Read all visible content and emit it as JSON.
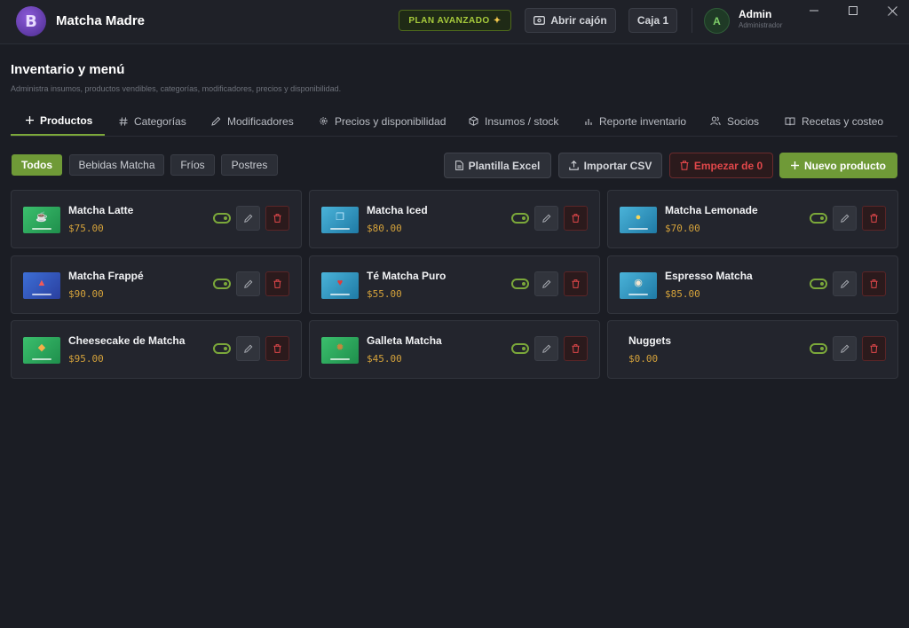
{
  "app": {
    "title": "Matcha Madre",
    "logo_letter": "B",
    "plan_badge": "PLAN AVANZADO",
    "open_drawer": "Abrir cajón",
    "register": "Caja 1",
    "user": {
      "initial": "A",
      "name": "Admin",
      "role": "Administrador"
    }
  },
  "page": {
    "title": "Inventario y menú",
    "subtitle": "Administra insumos, productos vendibles, categorías, modificadores, precios y disponibilidad."
  },
  "tabs": [
    {
      "label": "Productos",
      "icon": "plus-icon",
      "active": true
    },
    {
      "label": "Categorías",
      "icon": "hash-icon"
    },
    {
      "label": "Modificadores",
      "icon": "pencil-icon"
    },
    {
      "label": "Precios y disponibilidad",
      "icon": "gear-icon"
    },
    {
      "label": "Insumos / stock",
      "icon": "box-icon"
    },
    {
      "label": "Reporte inventario",
      "icon": "bar-chart-icon"
    },
    {
      "label": "Socios",
      "icon": "users-icon"
    },
    {
      "label": "Recetas y costeo",
      "icon": "book-icon"
    }
  ],
  "filters": [
    {
      "label": "Todos",
      "active": true
    },
    {
      "label": "Bebidas Matcha"
    },
    {
      "label": "Fríos"
    },
    {
      "label": "Postres"
    }
  ],
  "actions": {
    "template": "Plantilla Excel",
    "import": "Importar CSV",
    "reset": "Empezar de 0",
    "new_product": "Nuevo producto"
  },
  "products": [
    {
      "name": "Matcha Latte",
      "price": "$75.00",
      "thumb_icon": "cup-icon",
      "enabled": true
    },
    {
      "name": "Matcha Iced",
      "price": "$80.00",
      "thumb_icon": "ice-cube-icon",
      "enabled": true
    },
    {
      "name": "Matcha Lemonade",
      "price": "$70.00",
      "thumb_icon": "lemon-icon",
      "enabled": true
    },
    {
      "name": "Matcha Frappé",
      "price": "$90.00",
      "thumb_icon": "frappe-cup-icon",
      "enabled": true
    },
    {
      "name": "Té Matcha Puro",
      "price": "$55.00",
      "thumb_icon": "tea-icon",
      "enabled": true
    },
    {
      "name": "Espresso Matcha",
      "price": "$85.00",
      "thumb_icon": "espresso-icon",
      "enabled": true
    },
    {
      "name": "Cheesecake de Matcha",
      "price": "$95.00",
      "thumb_icon": "cake-icon",
      "enabled": true
    },
    {
      "name": "Galleta Matcha",
      "price": "$45.00",
      "thumb_icon": "cookie-icon",
      "enabled": true
    },
    {
      "name": "Nuggets",
      "price": "$0.00",
      "thumb_icon": "",
      "enabled": true
    }
  ]
}
